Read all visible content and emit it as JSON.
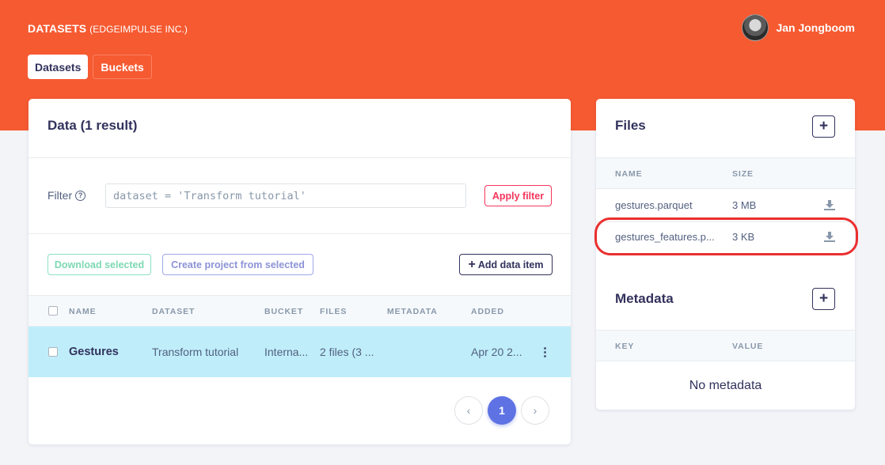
{
  "header": {
    "title": "DATASETS",
    "org": "(EDGEIMPULSE INC.)",
    "user_name": "Jan Jongboom",
    "accent_color": "#f65a31"
  },
  "tabs": [
    {
      "label": "Datasets",
      "active": true
    },
    {
      "label": "Buckets",
      "active": false
    }
  ],
  "data_card": {
    "title": "Data (1 result)",
    "filter_label": "Filter",
    "filter_value": "dataset = 'Transform tutorial'",
    "apply_filter_label": "Apply filter",
    "download_selected_label": "Download selected",
    "create_project_label": "Create project from selected",
    "add_item_label": "Add data item",
    "columns": [
      "NAME",
      "DATASET",
      "BUCKET",
      "FILES",
      "METADATA",
      "ADDED"
    ],
    "rows": [
      {
        "name": "Gestures",
        "dataset": "Transform tutorial",
        "bucket": "Interna...",
        "files": "2 files (3 ...",
        "metadata": "",
        "added": "Apr 20 2..."
      }
    ],
    "pagination": {
      "current": "1",
      "prev": "‹",
      "next": "›"
    }
  },
  "files_card": {
    "title": "Files",
    "columns": [
      "NAME",
      "SIZE"
    ],
    "files": [
      {
        "name": "gestures.parquet",
        "size": "3 MB"
      },
      {
        "name": "gestures_features.p...",
        "size": "3 KB"
      }
    ]
  },
  "metadata_card": {
    "title": "Metadata",
    "columns": [
      "KEY",
      "VALUE"
    ],
    "empty_text": "No metadata"
  },
  "icons": {
    "help": "question-circle-icon",
    "add": "plus-icon",
    "download": "download-icon",
    "kebab": "more-vertical-icon"
  }
}
